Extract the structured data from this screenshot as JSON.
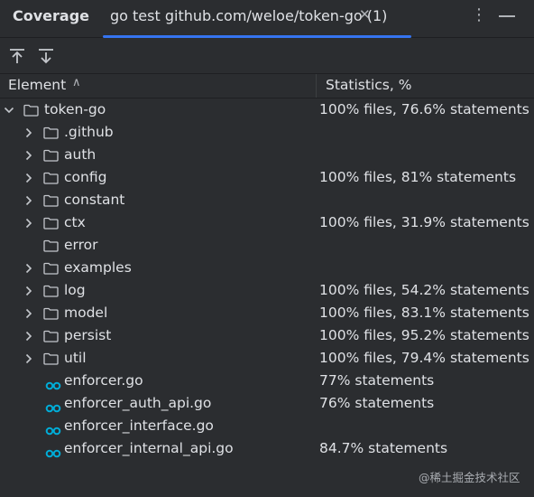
{
  "panel": {
    "title": "Coverage"
  },
  "tab": {
    "label": "go test github.com/weloe/token-go (1)",
    "close_glyph": "✕"
  },
  "window": {
    "menu_glyph": "⋮"
  },
  "toolbar": {
    "buttons": [
      {
        "icon": "export-up-icon"
      },
      {
        "icon": "import-down-icon"
      }
    ]
  },
  "columns": {
    "element": "Element",
    "sort_glyph": "∧",
    "statistics": "Statistics, %"
  },
  "tree": [
    {
      "name": "token-go",
      "type": "folder",
      "depth": 0,
      "expanded": true,
      "stat": "100% files, 76.6% statements"
    },
    {
      "name": ".github",
      "type": "folder",
      "depth": 1,
      "expandable": true,
      "stat": ""
    },
    {
      "name": "auth",
      "type": "folder",
      "depth": 1,
      "expandable": true,
      "stat": ""
    },
    {
      "name": "config",
      "type": "folder",
      "depth": 1,
      "expandable": true,
      "stat": "100% files, 81% statements"
    },
    {
      "name": "constant",
      "type": "folder",
      "depth": 1,
      "expandable": true,
      "stat": ""
    },
    {
      "name": "ctx",
      "type": "folder",
      "depth": 1,
      "expandable": true,
      "stat": "100% files, 31.9% statements"
    },
    {
      "name": "error",
      "type": "folder",
      "depth": 1,
      "expandable": false,
      "stat": ""
    },
    {
      "name": "examples",
      "type": "folder",
      "depth": 1,
      "expandable": true,
      "stat": ""
    },
    {
      "name": "log",
      "type": "folder",
      "depth": 1,
      "expandable": true,
      "stat": "100% files, 54.2% statements"
    },
    {
      "name": "model",
      "type": "folder",
      "depth": 1,
      "expandable": true,
      "stat": "100% files, 83.1% statements"
    },
    {
      "name": "persist",
      "type": "folder",
      "depth": 1,
      "expandable": true,
      "stat": "100% files, 95.2% statements"
    },
    {
      "name": "util",
      "type": "folder",
      "depth": 1,
      "expandable": true,
      "stat": "100% files, 79.4% statements"
    },
    {
      "name": "enforcer.go",
      "type": "go-file",
      "depth": 1,
      "stat": "77% statements"
    },
    {
      "name": "enforcer_auth_api.go",
      "type": "go-file",
      "depth": 1,
      "stat": "76% statements"
    },
    {
      "name": "enforcer_interface.go",
      "type": "go-file",
      "depth": 1,
      "stat": ""
    },
    {
      "name": "enforcer_internal_api.go",
      "type": "go-file",
      "depth": 1,
      "stat": "84.7% statements"
    }
  ],
  "watermark": "@稀土掘金技术社区",
  "colors": {
    "background": "#2b2d30",
    "accent": "#3574f0",
    "go_icon": "#00add8",
    "text": "#dfe1e5"
  }
}
